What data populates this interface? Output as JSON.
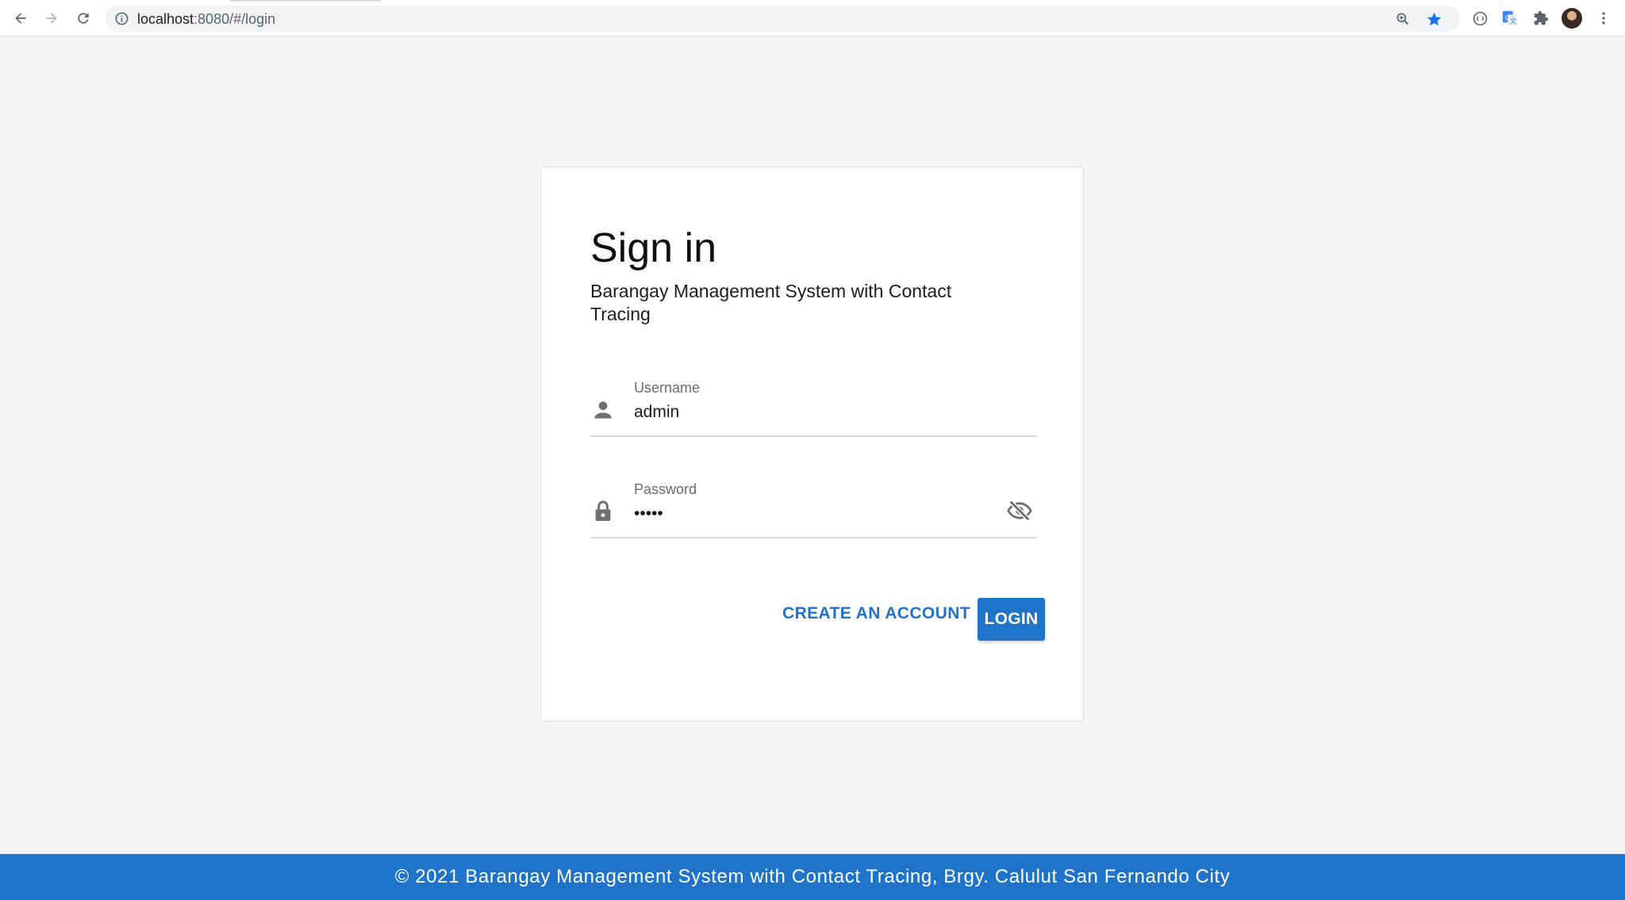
{
  "browser": {
    "url_host": "localhost",
    "url_rest": ":8080/#/login"
  },
  "login": {
    "title": "Sign in",
    "subtitle": "Barangay Management System with Contact Tracing",
    "username_label": "Username",
    "username_value": "admin",
    "password_label": "Password",
    "password_value": "admin",
    "create_account_label": "CREATE AN ACCOUNT",
    "login_label": "LOGIN"
  },
  "footer": {
    "text": "© 2021 Barangay Management System with Contact Tracing, Brgy. Calulut San Fernando City"
  },
  "colors": {
    "primary": "#1f73c8",
    "background": "#f4f4f4"
  },
  "icons": {
    "back": "arrow-left-icon",
    "forward": "arrow-right-icon",
    "reload": "reload-icon",
    "site_info": "info-icon",
    "zoom": "zoom-icon",
    "bookmark": "star-icon",
    "username": "person-icon",
    "password": "lock-icon",
    "visibility": "eye-off-icon"
  }
}
